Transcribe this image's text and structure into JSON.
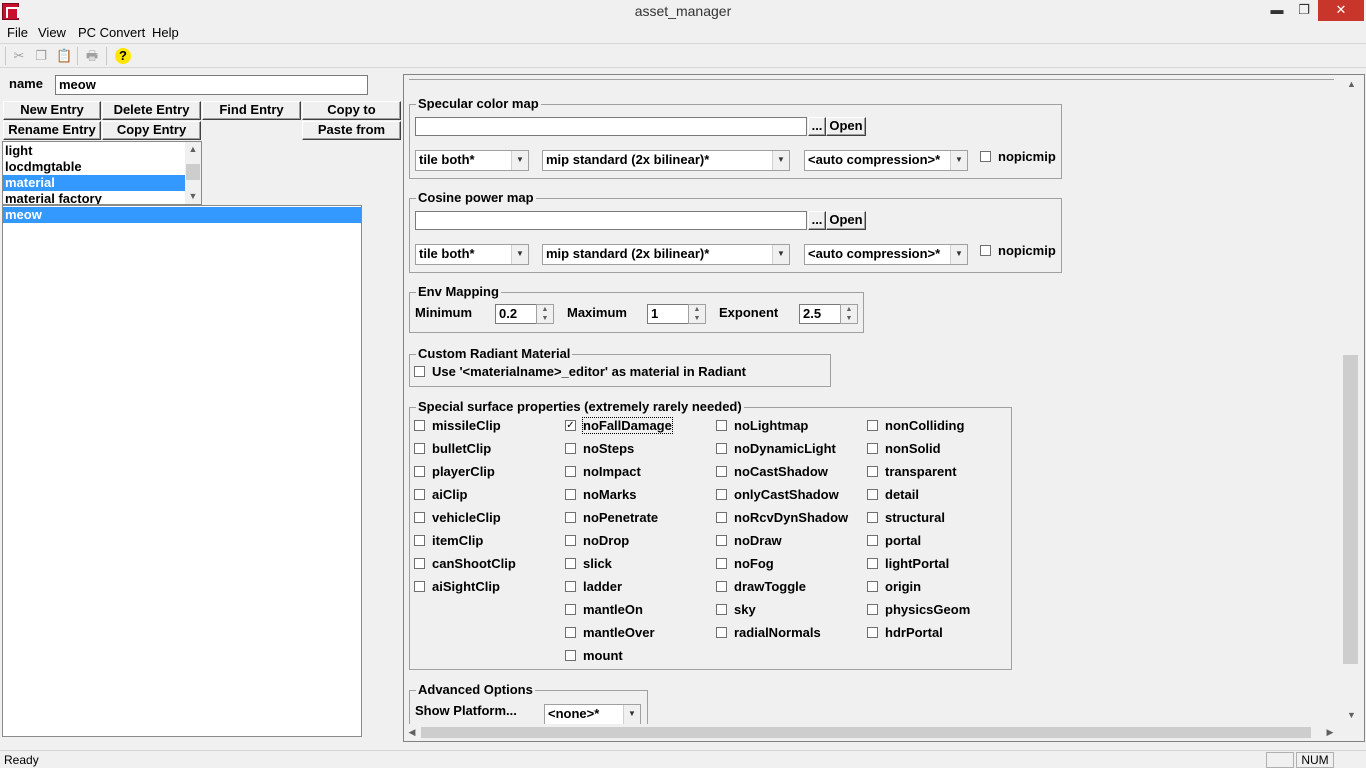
{
  "window": {
    "title": "asset_manager",
    "minimize": "▬",
    "maximize": "❐",
    "close": "✕"
  },
  "menu": [
    "File",
    "View",
    "PC Convert",
    "Help"
  ],
  "toolbar": {
    "icons": [
      "cut-icon",
      "copy-icon",
      "paste-icon",
      "print-icon",
      "help-icon"
    ],
    "glyphs": [
      "✂",
      "❐",
      "📋",
      "🖶",
      "?"
    ]
  },
  "left": {
    "name_label": "name",
    "name_value": "meow",
    "buttons": {
      "new_entry": "New Entry",
      "delete_entry": "Delete Entry",
      "find_entry": "Find Entry",
      "copy_to": "Copy to",
      "rename_entry": "Rename Entry",
      "copy_entry": "Copy Entry",
      "paste_from": "Paste from"
    },
    "types": [
      "light",
      "locdmgtable",
      "material",
      "material factory"
    ],
    "selected_type": "material",
    "entries": [
      "meow"
    ],
    "selected_entry": "meow"
  },
  "specular": {
    "title": "Specular color map",
    "path": "",
    "browse": "...",
    "open": "Open",
    "tile": "tile both*",
    "mip": "mip standard (2x bilinear)*",
    "compression": "<auto compression>*",
    "nopicmip": "nopicmip"
  },
  "cosine": {
    "title": "Cosine power map",
    "path": "",
    "browse": "...",
    "open": "Open",
    "tile": "tile both*",
    "mip": "mip standard (2x bilinear)*",
    "compression": "<auto compression>*",
    "nopicmip": "nopicmip"
  },
  "env": {
    "title": "Env Mapping",
    "minimum_label": "Minimum",
    "minimum": "0.2",
    "maximum_label": "Maximum",
    "maximum": "1",
    "exponent_label": "Exponent",
    "exponent": "2.5"
  },
  "custom_radiant": {
    "title": "Custom Radiant Material",
    "checkbox": "Use '<materialname>_editor' as material in Radiant"
  },
  "surface": {
    "title": "Special surface properties (extremely rarely needed)",
    "columns": [
      [
        "missileClip",
        "bulletClip",
        "playerClip",
        "aiClip",
        "vehicleClip",
        "itemClip",
        "canShootClip",
        "aiSightClip"
      ],
      [
        "noFallDamage",
        "noSteps",
        "noImpact",
        "noMarks",
        "noPenetrate",
        "noDrop",
        "slick",
        "ladder",
        "mantleOn",
        "mantleOver",
        "mount"
      ],
      [
        "noLightmap",
        "noDynamicLight",
        "noCastShadow",
        "onlyCastShadow",
        "noRcvDynShadow",
        "noDraw",
        "noFog",
        "drawToggle",
        "sky",
        "radialNormals"
      ],
      [
        "nonColliding",
        "nonSolid",
        "transparent",
        "detail",
        "structural",
        "portal",
        "lightPortal",
        "origin",
        "physicsGeom",
        "hdrPortal"
      ]
    ],
    "checked": [
      "noFallDamage"
    ]
  },
  "advanced": {
    "title": "Advanced Options",
    "platform_label": "Show Platform...",
    "platform": "<none>*"
  },
  "status": {
    "text": "Ready",
    "num": "NUM"
  }
}
